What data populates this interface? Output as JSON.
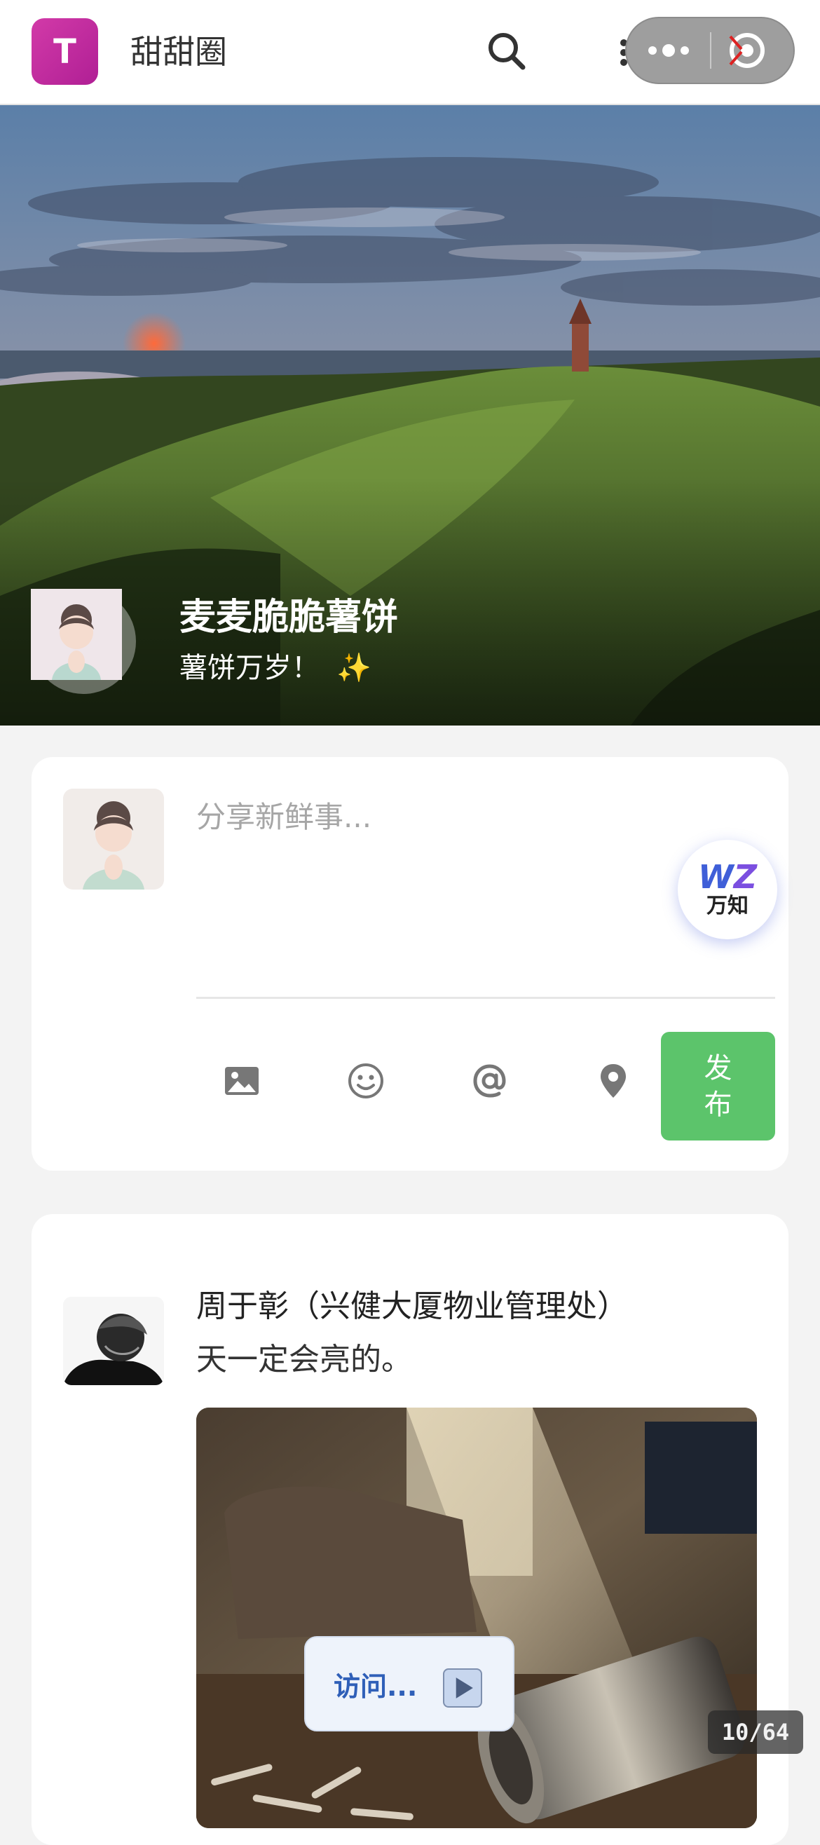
{
  "header": {
    "logo_letter": "T",
    "app_title": "甜甜圈",
    "search_icon": "search-icon",
    "more_icon": "more-dots-icon",
    "close_icon": "close-target-icon"
  },
  "cover": {
    "user_name": "麦麦脆脆薯饼",
    "signature": "薯饼万岁！",
    "signature_emoji": "✨"
  },
  "composer": {
    "placeholder": "分享新鲜事...",
    "tools": [
      "image-icon",
      "emoji-icon",
      "mention-icon",
      "location-icon"
    ],
    "publish_label": "发布",
    "wz_logo_w": "W",
    "wz_logo_z": "Z",
    "wz_label": "万知"
  },
  "post": {
    "author": "周于彰（兴健大厦物业管理处）",
    "text": "天一定会亮的。"
  },
  "overlay": {
    "visit_label": "访问...",
    "page_counter": "10/64"
  },
  "colors": {
    "publish_green": "#5cc46b",
    "logo_magenta": "#c42aa0",
    "wz_blue": "#3f5fd8"
  }
}
